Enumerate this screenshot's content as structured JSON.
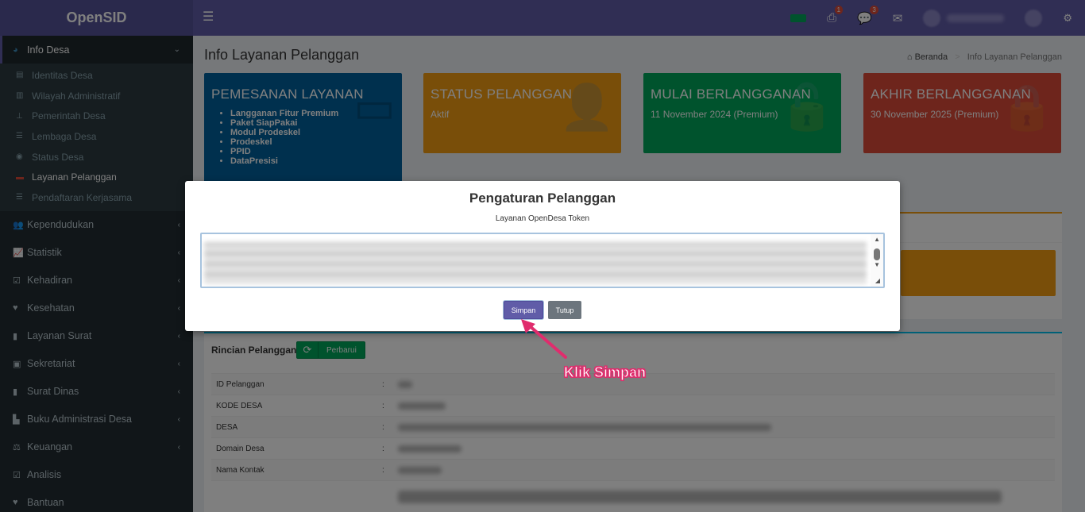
{
  "app": {
    "logo": "OpenSID"
  },
  "navbar": {
    "notif_print_count": "1",
    "notif_comment_count": "3"
  },
  "sidebar": {
    "items": [
      {
        "label": "Info Desa",
        "icon": "palette-icon",
        "active": true
      },
      {
        "label": "Kependudukan"
      },
      {
        "label": "Statistik"
      },
      {
        "label": "Kehadiran"
      },
      {
        "label": "Kesehatan"
      },
      {
        "label": "Layanan Surat"
      },
      {
        "label": "Sekretariat"
      },
      {
        "label": "Surat Dinas"
      },
      {
        "label": "Buku Administrasi Desa"
      },
      {
        "label": "Keuangan"
      },
      {
        "label": "Analisis"
      },
      {
        "label": "Bantuan"
      }
    ],
    "subitems": [
      {
        "label": "Identitas Desa"
      },
      {
        "label": "Wilayah Administratif"
      },
      {
        "label": "Pemerintah Desa"
      },
      {
        "label": "Lembaga Desa"
      },
      {
        "label": "Status Desa"
      },
      {
        "label": "Layanan Pelanggan",
        "current": true
      },
      {
        "label": "Pendaftaran Kerjasama"
      }
    ]
  },
  "page": {
    "title": "Info Layanan Pelanggan",
    "breadcrumb": {
      "home": "Beranda",
      "current": "Info Layanan Pelanggan"
    }
  },
  "cards": {
    "pemesanan": {
      "title": "PEMESANAN LAYANAN",
      "items": [
        "Langganan Fitur Premium",
        "Paket SiapPakai",
        "Modul Prodeskel",
        "Prodeskel",
        "PPID",
        "DataPresisi"
      ]
    },
    "status": {
      "title": "STATUS PELANGGAN",
      "value": "Aktif"
    },
    "mulai": {
      "title": "MULAI BERLANGGANAN",
      "value": "11 November 2024 (Premium)"
    },
    "akhir": {
      "title": "AKHIR BERLANGGANAN",
      "value": "30 November 2025 (Premium)"
    }
  },
  "detail": {
    "title": "Rincian Pelanggan",
    "refresh_label": "Perbarui",
    "rows": [
      {
        "key": "ID Pelanggan",
        "sep": ":"
      },
      {
        "key": "KODE DESA",
        "sep": ":"
      },
      {
        "key": "DESA",
        "sep": ":"
      },
      {
        "key": "Domain Desa",
        "sep": ":"
      },
      {
        "key": "Nama Kontak",
        "sep": ":"
      }
    ]
  },
  "modal": {
    "title": "Pengaturan Pelanggan",
    "field_label": "Layanan OpenDesa Token",
    "save_label": "Simpan",
    "close_label": "Tutup"
  },
  "annotation": {
    "text": "Klik Simpan",
    "color": "#e02c6d"
  },
  "colors": {
    "brand": "#605ca8",
    "sidebar": "#222d32",
    "blue": "#00609c",
    "orange": "#f39c12",
    "green": "#00a65a",
    "red": "#dd4b39"
  }
}
